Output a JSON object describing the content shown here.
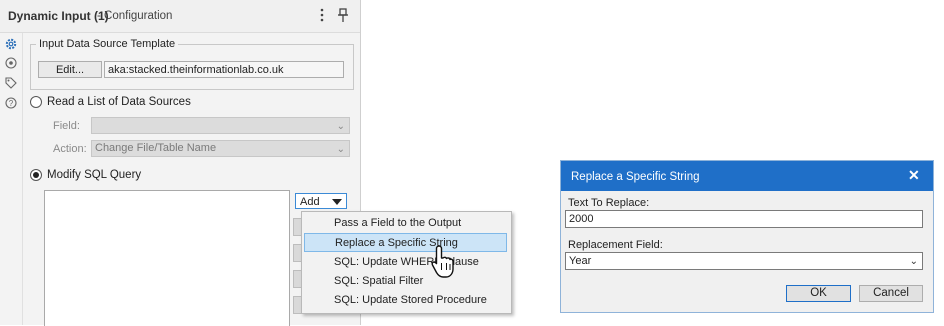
{
  "config_panel": {
    "title": "Dynamic Input (1)",
    "subtitle": "- Configuration",
    "icons": [
      "gear-icon",
      "settings-circle-icon",
      "tag-icon",
      "help-icon"
    ],
    "group_label": "Input Data Source Template",
    "edit_button": "Edit...",
    "source_value": "aka:stacked.theinformationlab.co.uk",
    "radio_read_list": {
      "label": "Read a List of Data Sources",
      "selected": false
    },
    "field_label": "Field:",
    "field_value": "",
    "action_label": "Action:",
    "action_value": "Change File/Table Name",
    "radio_modify_sql": {
      "label": "Modify SQL Query",
      "selected": true
    },
    "add_button": "Add"
  },
  "add_menu": {
    "items": [
      {
        "label": "Pass a Field to the Output",
        "selected": false
      },
      {
        "label": "Replace a Specific String",
        "selected": true
      },
      {
        "label": "SQL: Update WHERE Clause",
        "selected": false
      },
      {
        "label": "SQL: Spatial Filter",
        "selected": false
      },
      {
        "label": "SQL: Update Stored Procedure",
        "selected": false
      }
    ]
  },
  "dialog": {
    "title": "Replace a Specific String",
    "close_glyph": "✕",
    "text_to_replace_label": "Text To Replace:",
    "text_to_replace_value": "2000",
    "replacement_field_label": "Replacement Field:",
    "replacement_field_value": "Year",
    "ok_button": "OK",
    "cancel_button": "Cancel"
  },
  "colors": {
    "accent": "#1f6fc8",
    "selection": "#cce4f7"
  }
}
